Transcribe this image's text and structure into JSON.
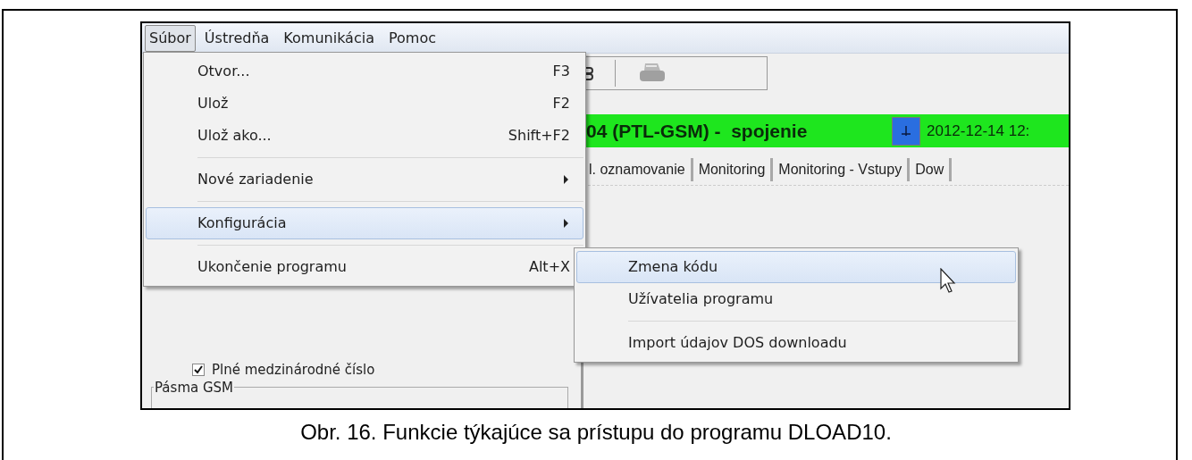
{
  "menu_bar": [
    {
      "label": "Súbor",
      "selected": true
    },
    {
      "label": "Ústredňa",
      "selected": false
    },
    {
      "label": "Komunikácia",
      "selected": false
    },
    {
      "label": "Pomoc",
      "selected": false
    }
  ],
  "status_bar": {
    "device": "04 (PTL-GSM) -  spojenie",
    "datetime": "2012-12-14 12:"
  },
  "tabs": [
    "l. oznamovanie",
    "Monitoring",
    "Monitoring - Vstupy",
    "Dow"
  ],
  "panel": {
    "checkbox": {
      "label": "Plné medzinárodné číslo",
      "checked": true
    },
    "group": "Pásma GSM"
  },
  "file_menu": [
    {
      "kind": "item",
      "label": "Otvor...",
      "shortcut": "F3",
      "selected": false
    },
    {
      "kind": "item",
      "label": "Ulož",
      "shortcut": "F2",
      "selected": false
    },
    {
      "kind": "item",
      "label": "Ulož ako...",
      "shortcut": "Shift+F2",
      "selected": false
    },
    {
      "kind": "separator"
    },
    {
      "kind": "submenu",
      "label": "Nové zariadenie",
      "selected": false
    },
    {
      "kind": "separator"
    },
    {
      "kind": "submenu",
      "label": "Konfigurácia",
      "selected": true
    },
    {
      "kind": "separator"
    },
    {
      "kind": "item",
      "label": "Ukončenie programu",
      "shortcut": "Alt+X",
      "selected": false
    }
  ],
  "config_submenu": [
    {
      "kind": "item",
      "label": "Zmena kódu",
      "selected": true
    },
    {
      "kind": "item",
      "label": "Užívatelia programu",
      "selected": false
    },
    {
      "kind": "separator"
    },
    {
      "kind": "item",
      "label": "Import údajov DOS downloadu",
      "selected": false
    }
  ],
  "caption": "Obr. 16. Funkcie týkajúce sa prístupu do programu DLOAD10."
}
